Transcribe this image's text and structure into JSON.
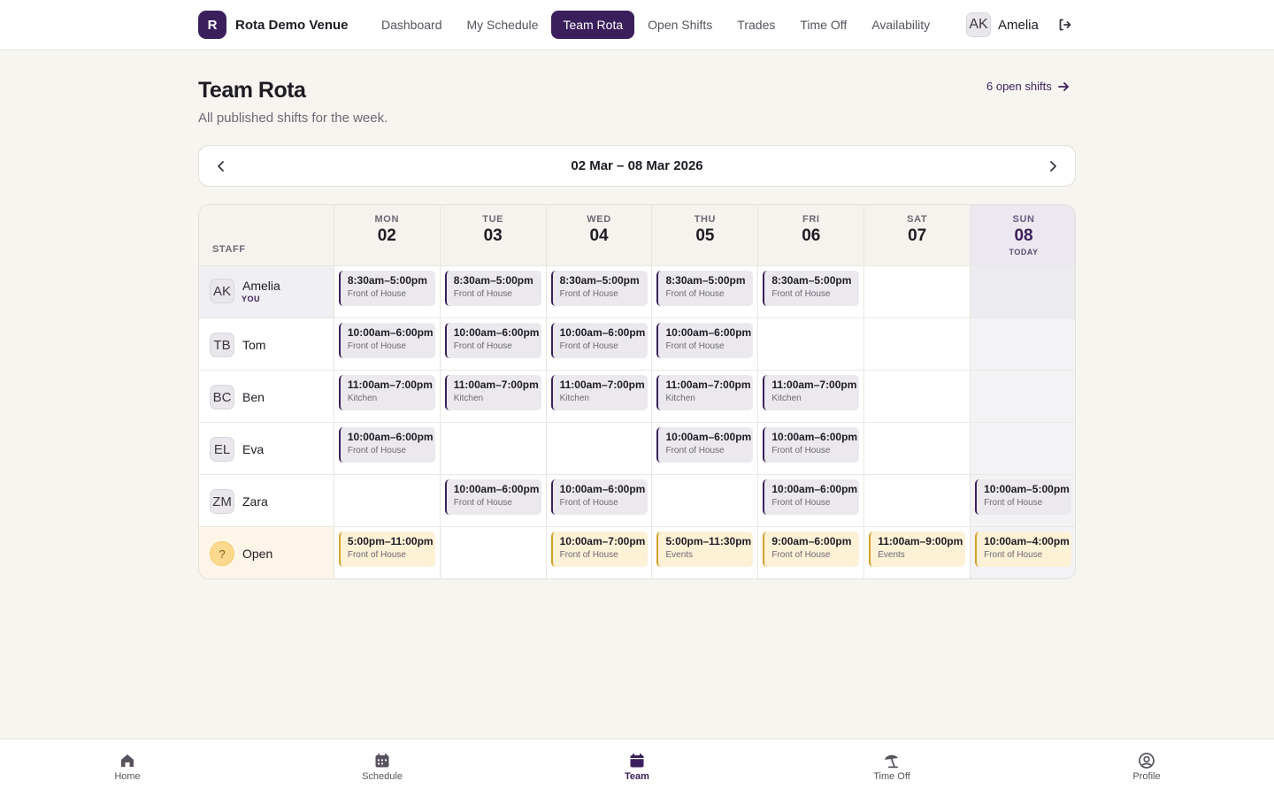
{
  "brand": {
    "logo_letter": "R",
    "name": "Rota Demo Venue"
  },
  "nav": [
    {
      "label": "Dashboard",
      "active": false
    },
    {
      "label": "My Schedule",
      "active": false
    },
    {
      "label": "Team Rota",
      "active": true
    },
    {
      "label": "Open Shifts",
      "active": false
    },
    {
      "label": "Trades",
      "active": false
    },
    {
      "label": "Time Off",
      "active": false
    },
    {
      "label": "Availability",
      "active": false
    }
  ],
  "user": {
    "initials": "AK",
    "name": "Amelia",
    "logout_icon": "logout-icon"
  },
  "page": {
    "title": "Team Rota",
    "subtitle": "All published shifts for the week.",
    "open_shifts_link": "6 open shifts"
  },
  "week": {
    "range": "02 Mar – 08 Mar 2026"
  },
  "grid": {
    "staff_header": "STAFF",
    "days": [
      {
        "dow": "MON",
        "num": "02"
      },
      {
        "dow": "TUE",
        "num": "03"
      },
      {
        "dow": "WED",
        "num": "04"
      },
      {
        "dow": "THU",
        "num": "05"
      },
      {
        "dow": "FRI",
        "num": "06"
      },
      {
        "dow": "SAT",
        "num": "07"
      },
      {
        "dow": "SUN",
        "num": "08",
        "today_label": "TODAY"
      }
    ],
    "rows": [
      {
        "initials": "AK",
        "name": "Amelia",
        "tag": "YOU",
        "type": "me",
        "shifts": [
          {
            "time": "8:30am–5:00pm",
            "role": "Front of House"
          },
          {
            "time": "8:30am–5:00pm",
            "role": "Front of House"
          },
          {
            "time": "8:30am–5:00pm",
            "role": "Front of House"
          },
          {
            "time": "8:30am–5:00pm",
            "role": "Front of House"
          },
          {
            "time": "8:30am–5:00pm",
            "role": "Front of House"
          },
          null,
          null
        ]
      },
      {
        "initials": "TB",
        "name": "Tom",
        "type": "staff",
        "shifts": [
          {
            "time": "10:00am–6:00pm",
            "role": "Front of House"
          },
          {
            "time": "10:00am–6:00pm",
            "role": "Front of House"
          },
          {
            "time": "10:00am–6:00pm",
            "role": "Front of House"
          },
          {
            "time": "10:00am–6:00pm",
            "role": "Front of House"
          },
          null,
          null,
          null
        ]
      },
      {
        "initials": "BC",
        "name": "Ben",
        "type": "staff",
        "shifts": [
          {
            "time": "11:00am–7:00pm",
            "role": "Kitchen"
          },
          {
            "time": "11:00am–7:00pm",
            "role": "Kitchen"
          },
          {
            "time": "11:00am–7:00pm",
            "role": "Kitchen"
          },
          {
            "time": "11:00am–7:00pm",
            "role": "Kitchen"
          },
          {
            "time": "11:00am–7:00pm",
            "role": "Kitchen"
          },
          null,
          null
        ]
      },
      {
        "initials": "EL",
        "name": "Eva",
        "type": "staff",
        "shifts": [
          {
            "time": "10:00am–6:00pm",
            "role": "Front of House"
          },
          null,
          null,
          {
            "time": "10:00am–6:00pm",
            "role": "Front of House"
          },
          {
            "time": "10:00am–6:00pm",
            "role": "Front of House"
          },
          null,
          null
        ]
      },
      {
        "initials": "ZM",
        "name": "Zara",
        "type": "staff",
        "shifts": [
          null,
          {
            "time": "10:00am–6:00pm",
            "role": "Front of House"
          },
          {
            "time": "10:00am–6:00pm",
            "role": "Front of House"
          },
          null,
          {
            "time": "10:00am–6:00pm",
            "role": "Front of House"
          },
          null,
          {
            "time": "10:00am–5:00pm",
            "role": "Front of House"
          }
        ]
      },
      {
        "initials": "?",
        "name": "Open",
        "type": "open",
        "shifts": [
          {
            "time": "5:00pm–11:00pm",
            "role": "Front of House"
          },
          null,
          {
            "time": "10:00am–7:00pm",
            "role": "Front of House"
          },
          {
            "time": "5:00pm–11:30pm",
            "role": "Events"
          },
          {
            "time": "9:00am–6:00pm",
            "role": "Front of House"
          },
          {
            "time": "11:00am–9:00pm",
            "role": "Events"
          },
          {
            "time": "10:00am–4:00pm",
            "role": "Front of House"
          }
        ]
      }
    ]
  },
  "tabs": [
    {
      "label": "Home",
      "icon": "home-icon",
      "active": false
    },
    {
      "label": "Schedule",
      "icon": "calendar-icon",
      "active": false
    },
    {
      "label": "Team",
      "icon": "calendar-icon",
      "active": true
    },
    {
      "label": "Time Off",
      "icon": "beach-umbrella-icon",
      "active": false
    },
    {
      "label": "Profile",
      "icon": "user-circle-icon",
      "active": false
    }
  ],
  "colors": {
    "accent": "#3b1f5c",
    "open": "#d5a12a",
    "background": "#f7f5f0"
  }
}
